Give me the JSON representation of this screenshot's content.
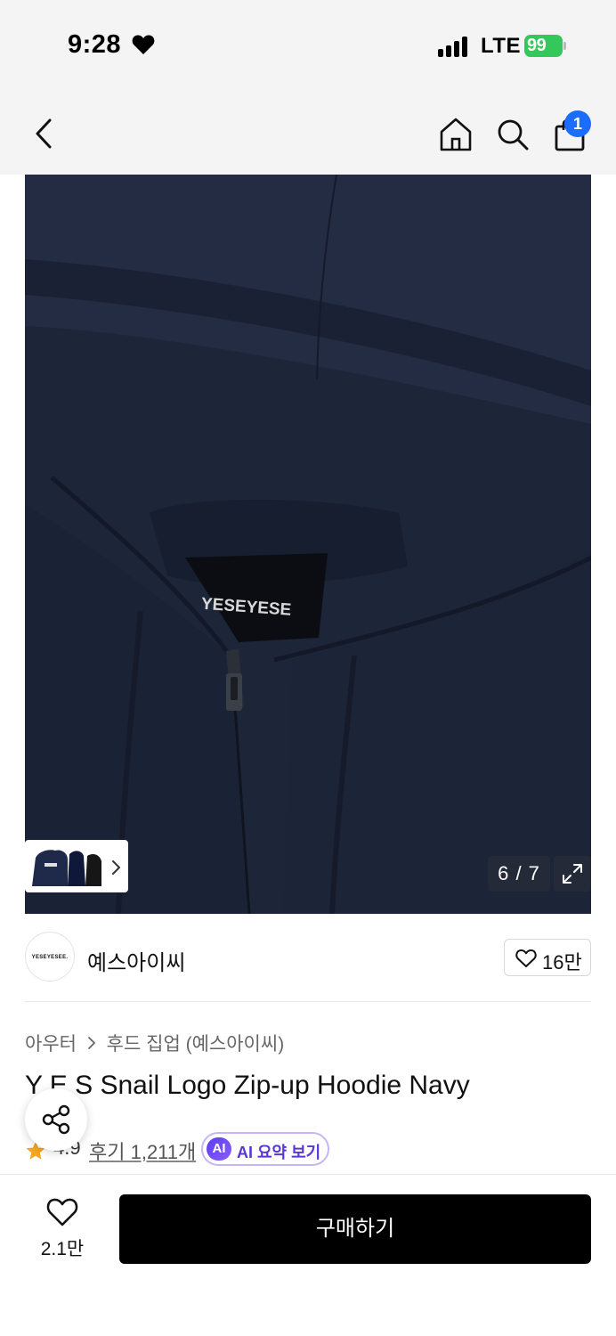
{
  "status_bar": {
    "time": "9:28",
    "network": "LTE",
    "battery": "99"
  },
  "nav": {
    "cart_count": "1"
  },
  "product_image": {
    "counter": "6 / 7",
    "tag_text": "YESEYESE"
  },
  "brand": {
    "name": "예스아이씨",
    "logo_text": "YESEYESEE.",
    "likes": "16만"
  },
  "breadcrumb": {
    "category": "아우터",
    "subcategory": "후드 집업 (예스아이씨)"
  },
  "product": {
    "title": "Y E S Snail Logo Zip-up Hoodie Navy"
  },
  "rating": {
    "value": "4.9",
    "reviews": "후기 1,211개",
    "ai_badge": "AI",
    "ai_label": "AI 요약 보기"
  },
  "bottom_bar": {
    "wish_count": "2.1만",
    "buy_label": "구매하기"
  },
  "colors": {
    "accent_blue": "#1a6dff",
    "rating_star": "#f5a623",
    "ai_purple": "#5a36d6",
    "buy_button": "#000000",
    "battery_green": "#34c759"
  },
  "icons": [
    "heart-icon",
    "back-chevron-icon",
    "home-icon",
    "search-icon",
    "shopping-bag-icon",
    "chevron-right-icon",
    "expand-icon",
    "share-icon",
    "star-icon"
  ]
}
